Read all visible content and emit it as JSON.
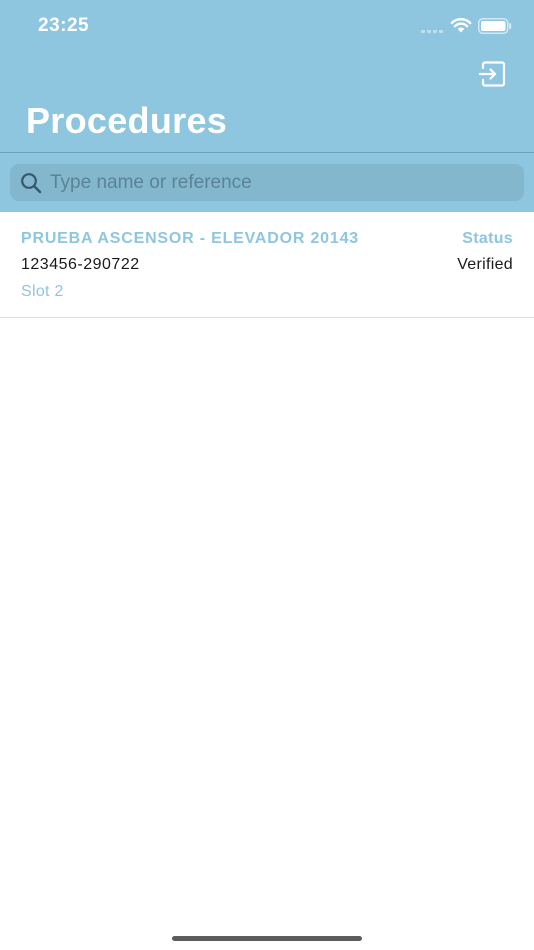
{
  "status_bar": {
    "time": "23:25"
  },
  "header": {
    "title": "Procedures",
    "logout_icon": "logout-icon"
  },
  "search": {
    "placeholder": "Type name or reference",
    "value": "",
    "icon": "search-icon"
  },
  "procedures": [
    {
      "title": "PRUEBA ASCENSOR - ELEVADOR 20143",
      "reference": "123456-290722",
      "slot": "Slot 2",
      "status_label": "Status",
      "status_value": "Verified"
    }
  ],
  "colors": {
    "header_bg": "#8ec6df",
    "accent": "#8ec6df",
    "search_bg": "#82b7cd",
    "text": "#1a1a1a"
  }
}
